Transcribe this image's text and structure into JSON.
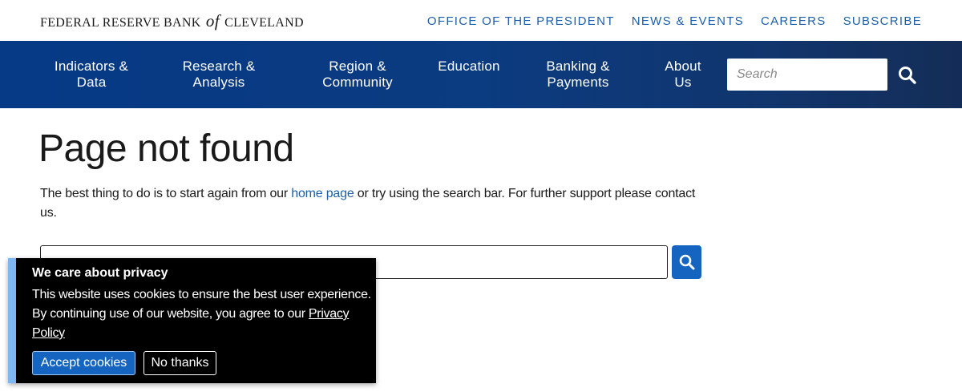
{
  "brand": {
    "logo_part1": "FEDERAL RESERVE BANK",
    "logo_of": "of",
    "logo_part2": "CLEVELAND"
  },
  "utility_nav": [
    "OFFICE OF THE PRESIDENT",
    "NEWS & EVENTS",
    "CAREERS",
    "SUBSCRIBE"
  ],
  "main_nav": {
    "items": [
      {
        "line1": "Indicators &",
        "line2": "Data"
      },
      {
        "line1": "Research &",
        "line2": "Analysis"
      },
      {
        "line1": "Region &",
        "line2": "Community"
      },
      {
        "line1": "Education",
        "line2": ""
      },
      {
        "line1": "Banking &",
        "line2": "Payments"
      },
      {
        "line1": "About",
        "line2": "Us"
      }
    ],
    "search_placeholder": "Search",
    "search_icon": "search-icon"
  },
  "main": {
    "title": "Page not found",
    "intro_before": "The best thing to do is to start again from our ",
    "intro_link": "home page",
    "intro_after": " or try using the search bar. For further support please contact us.",
    "search_value": "",
    "search_icon": "search-icon"
  },
  "cookie_banner": {
    "title": "We care about privacy",
    "text_before": "This website uses cookies to ensure the best user experience. By continuing use of our website, you agree to our ",
    "policy_link": "Privacy Policy",
    "accept_label": "Accept cookies",
    "decline_label": "No thanks"
  },
  "colors": {
    "accent_blue": "#1d5fa8",
    "nav_gradient_start": "#063a86",
    "nav_gradient_end": "#142d57",
    "button_blue": "#1565c0",
    "cookie_stripe": "#7fb6ef"
  }
}
